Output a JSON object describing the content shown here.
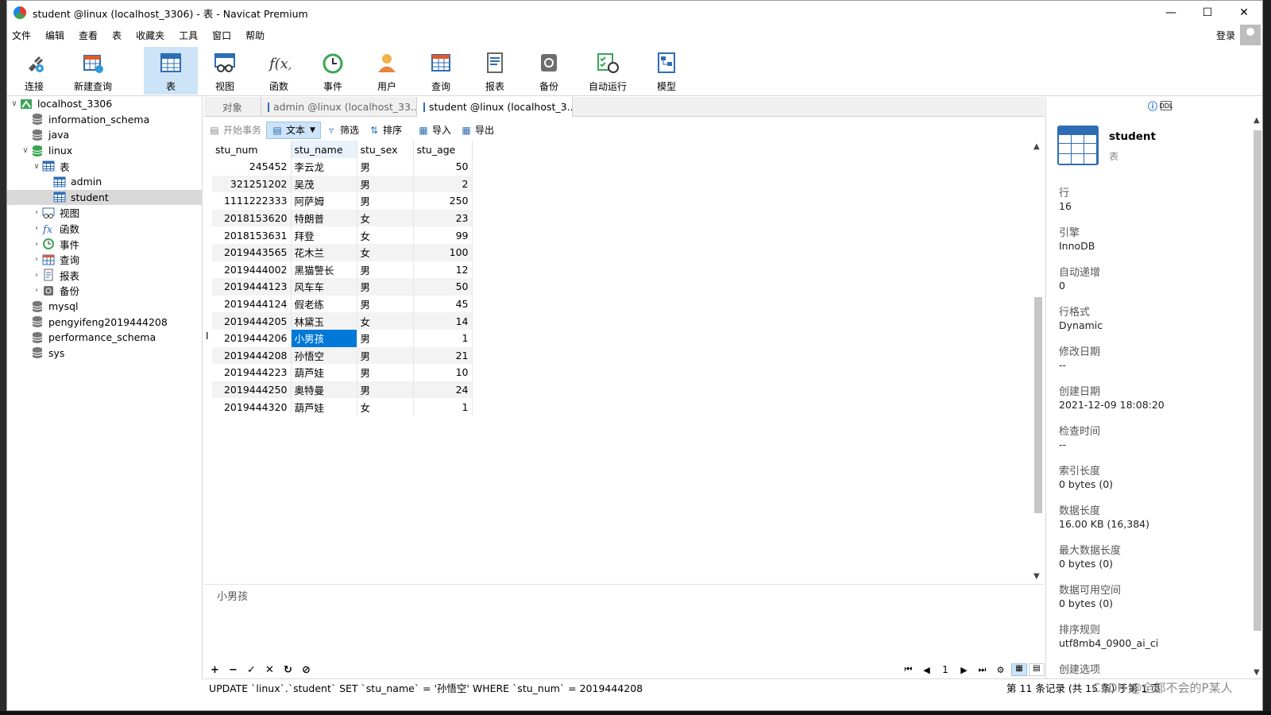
{
  "window": {
    "title": "student @linux (localhost_3306) - 表 - Navicat Premium"
  },
  "menu": [
    "文件",
    "编辑",
    "查看",
    "表",
    "收藏夹",
    "工具",
    "窗口",
    "帮助"
  ],
  "login_label": "登录",
  "toolbar": [
    {
      "label": "连接",
      "icon": "plug-icon"
    },
    {
      "label": "新建查询",
      "icon": "new-query-icon"
    },
    {
      "label": "表",
      "icon": "table-icon",
      "active": true
    },
    {
      "label": "视图",
      "icon": "view-icon"
    },
    {
      "label": "函数",
      "icon": "function-icon"
    },
    {
      "label": "事件",
      "icon": "clock-icon"
    },
    {
      "label": "用户",
      "icon": "user-icon"
    },
    {
      "label": "查询",
      "icon": "query-icon"
    },
    {
      "label": "报表",
      "icon": "report-icon"
    },
    {
      "label": "备份",
      "icon": "backup-icon"
    },
    {
      "label": "自动运行",
      "icon": "schedule-icon"
    },
    {
      "label": "模型",
      "icon": "model-icon"
    }
  ],
  "nav": [
    {
      "label": "localhost_3306",
      "level": 0,
      "toggle": "expanded",
      "icon": "connection-icon"
    },
    {
      "label": "information_schema",
      "level": 1,
      "icon": "database-icon"
    },
    {
      "label": "java",
      "level": 1,
      "icon": "database-icon"
    },
    {
      "label": "linux",
      "level": 1,
      "toggle": "expanded",
      "icon": "database-active-icon"
    },
    {
      "label": "表",
      "level": 2,
      "toggle": "expanded",
      "icon": "table-icon"
    },
    {
      "label": "admin",
      "level": 3,
      "icon": "table-icon"
    },
    {
      "label": "student",
      "level": 3,
      "icon": "table-icon",
      "selected": true
    },
    {
      "label": "视图",
      "level": 2,
      "toggle": "collapsed",
      "icon": "view-icon"
    },
    {
      "label": "函数",
      "level": 2,
      "toggle": "collapsed",
      "icon": "function-icon"
    },
    {
      "label": "事件",
      "level": 2,
      "toggle": "collapsed",
      "icon": "clock-icon"
    },
    {
      "label": "查询",
      "level": 2,
      "toggle": "collapsed",
      "icon": "query-icon"
    },
    {
      "label": "报表",
      "level": 2,
      "toggle": "collapsed",
      "icon": "report-icon"
    },
    {
      "label": "备份",
      "level": 2,
      "toggle": "collapsed",
      "icon": "backup-icon"
    },
    {
      "label": "mysql",
      "level": 1,
      "icon": "database-icon"
    },
    {
      "label": "pengyifeng2019444208",
      "level": 1,
      "icon": "database-icon"
    },
    {
      "label": "performance_schema",
      "level": 1,
      "icon": "database-icon"
    },
    {
      "label": "sys",
      "level": 1,
      "icon": "database-icon"
    }
  ],
  "tabs": [
    {
      "label": "对象",
      "active": false,
      "icon": false
    },
    {
      "label": "admin @linux (localhost_33...",
      "active": false,
      "icon": true
    },
    {
      "label": "student @linux (localhost_3...",
      "active": true,
      "icon": true
    }
  ],
  "gridbar": {
    "begin_tx": "开始事务",
    "text": "文本",
    "filter": "筛选",
    "sort": "排序",
    "import": "导入",
    "export": "导出"
  },
  "columns": [
    "stu_num",
    "stu_name",
    "stu_sex",
    "stu_age"
  ],
  "rows": [
    [
      "245452",
      "李云龙",
      "男",
      "50"
    ],
    [
      "321251202",
      "吴茂",
      "男",
      "2"
    ],
    [
      "1111222333",
      "阿萨姆",
      "男",
      "250"
    ],
    [
      "2018153620",
      "特朗普",
      "女",
      "23"
    ],
    [
      "2018153631",
      "拜登",
      "女",
      "99"
    ],
    [
      "2019443565",
      "花木兰",
      "女",
      "100"
    ],
    [
      "2019444002",
      "黑猫警长",
      "男",
      "12"
    ],
    [
      "2019444123",
      "风车车",
      "男",
      "50"
    ],
    [
      "2019444124",
      "假老练",
      "男",
      "45"
    ],
    [
      "2019444205",
      "林黛玉",
      "女",
      "14"
    ],
    [
      "2019444206",
      "小男孩",
      "男",
      "1"
    ],
    [
      "2019444208",
      "孙悟空",
      "男",
      "21"
    ],
    [
      "2019444223",
      "葫芦娃",
      "男",
      "10"
    ],
    [
      "2019444250",
      "奥特曼",
      "男",
      "24"
    ],
    [
      "2019444320",
      "葫芦娃",
      "女",
      "1"
    ]
  ],
  "selected_row": 10,
  "preview_text": "小男孩",
  "pager": {
    "page": "1"
  },
  "status": {
    "sql": "UPDATE `linux`.`student` SET `stu_name` = '孙悟空' WHERE `stu_num` = 2019444208",
    "record": "第 11 条记录 (共 15 条) 于第 1 页",
    "watermark": "CSDN @全都不会的P某人"
  },
  "info": {
    "name": "student",
    "kind": "表",
    "props": [
      {
        "k": "行",
        "v": "16"
      },
      {
        "k": "引擎",
        "v": "InnoDB"
      },
      {
        "k": "自动递增",
        "v": "0"
      },
      {
        "k": "行格式",
        "v": "Dynamic"
      },
      {
        "k": "修改日期",
        "v": "--"
      },
      {
        "k": "创建日期",
        "v": "2021-12-09 18:08:20"
      },
      {
        "k": "检查时间",
        "v": "--"
      },
      {
        "k": "索引长度",
        "v": "0 bytes (0)"
      },
      {
        "k": "数据长度",
        "v": "16.00 KB (16,384)"
      },
      {
        "k": "最大数据长度",
        "v": "0 bytes (0)"
      },
      {
        "k": "数据可用空间",
        "v": "0 bytes (0)"
      },
      {
        "k": "排序规则",
        "v": "utf8mb4_0900_ai_ci"
      },
      {
        "k": "创建选项",
        "v": ""
      }
    ]
  },
  "colors": {
    "accent": "#0078d7",
    "active_bg": "#cde3f7",
    "icon_blue": "#2e6db4"
  }
}
